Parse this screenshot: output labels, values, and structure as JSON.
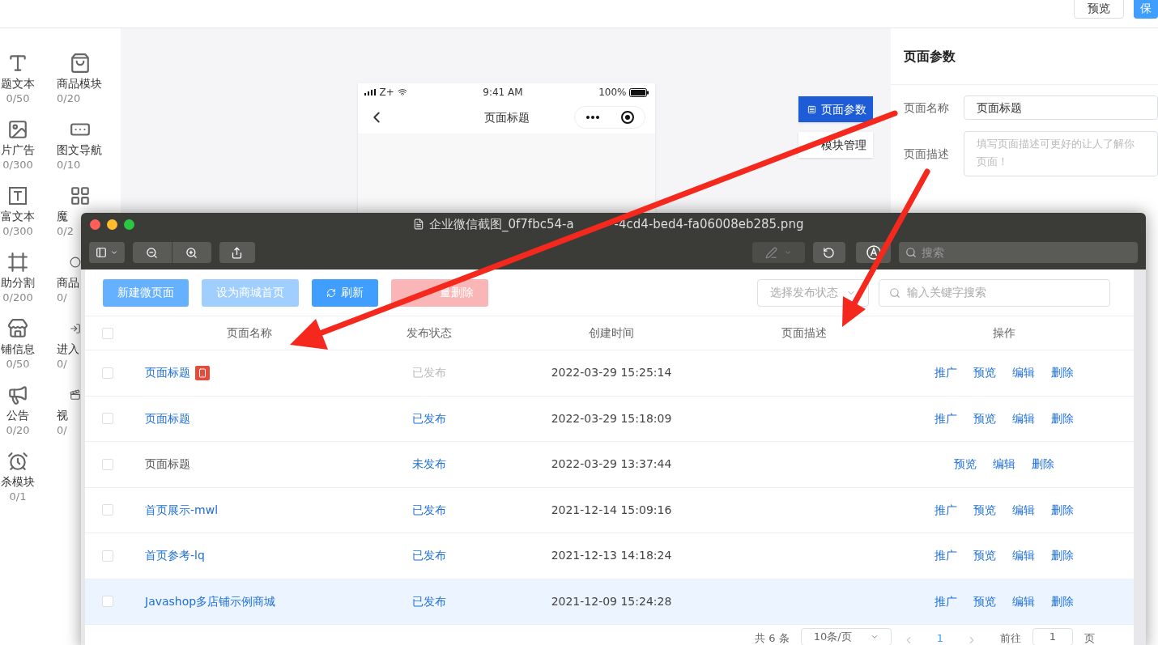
{
  "header": {
    "buttons": [
      {
        "label": "预览",
        "kind": "plain"
      },
      {
        "label": "保",
        "kind": "primary"
      }
    ]
  },
  "components": [
    {
      "label": "题文本",
      "count": "0/50"
    },
    {
      "label": "商品模块",
      "count": "0/20"
    },
    {
      "label": "片广告",
      "count": "0/300"
    },
    {
      "label": "图文导航",
      "count": "0/10"
    },
    {
      "label": "富文本",
      "count": "0/300"
    },
    {
      "label": "魔",
      "count": "0/2"
    },
    {
      "label": "助分割",
      "count": "0/200"
    },
    {
      "label": "商品",
      "count": "0/"
    },
    {
      "label": "铺信息",
      "count": "0/50"
    },
    {
      "label": "进入",
      "count": "0/"
    },
    {
      "label": "公告",
      "count": "0/20"
    },
    {
      "label": "视",
      "count": "0/"
    },
    {
      "label": "杀模块",
      "count": "0/1"
    }
  ],
  "phone": {
    "carrier": "Z+",
    "time": "9:41 AM",
    "battery": "100%",
    "title": "页面标题"
  },
  "canvas_tabs": [
    {
      "label": "页面参数",
      "selected": true
    },
    {
      "label": "模块管理",
      "selected": false
    }
  ],
  "settings": {
    "title": "页面参数",
    "fields": [
      {
        "label": "页面名称",
        "kind": "input",
        "value": "页面标题"
      },
      {
        "label": "页面描述",
        "kind": "textarea",
        "placeholder_lines": [
          "填写页面描述可更好的让人了解你",
          "页面！"
        ]
      }
    ]
  },
  "preview_window": {
    "title_start": "企业微信截图_0f7fbc54-a",
    "title_end": "-4cd4-bed4-fa06008eb285.png",
    "search_placeholder": "搜索",
    "toolbar_buttons": [
      {
        "label": "新建微页面",
        "kind": "primary"
      },
      {
        "label": "设为商城首页",
        "kind": "primary_disabled"
      },
      {
        "label": "刷新",
        "kind": "refresh"
      },
      {
        "label": "量删除",
        "kind": "danger_disabled"
      }
    ],
    "select_all_checked": false,
    "status_filter": {
      "placeholder": "选择发布状态"
    },
    "search": {
      "placeholder": "输入关键字搜索"
    },
    "columns": [
      "页面名称",
      "发布状态",
      "创建时间",
      "页面描述",
      "操作"
    ],
    "rows": [
      {
        "checked": false,
        "selected": false,
        "name": "页面标题",
        "linked": true,
        "badge": true,
        "status": "已发布",
        "status_disabled": true,
        "created": "2022-03-29 15:25:14",
        "actions": [
          "推广",
          "预览",
          "编辑",
          "删除"
        ]
      },
      {
        "checked": false,
        "selected": false,
        "name": "页面标题",
        "linked": true,
        "badge": false,
        "status": "已发布",
        "status_disabled": false,
        "created": "2022-03-29 15:18:09",
        "actions": [
          "推广",
          "预览",
          "编辑",
          "删除"
        ]
      },
      {
        "checked": false,
        "selected": false,
        "name": "页面标题",
        "linked": false,
        "badge": false,
        "status": "未发布",
        "status_disabled": false,
        "created": "2022-03-29 13:37:44",
        "actions": [
          "预览",
          "编辑",
          "删除"
        ]
      },
      {
        "checked": false,
        "selected": false,
        "name": "首页展示-mwl",
        "linked": true,
        "badge": false,
        "status": "已发布",
        "status_disabled": false,
        "created": "2021-12-14 15:09:16",
        "actions": [
          "推广",
          "预览",
          "编辑",
          "删除"
        ]
      },
      {
        "checked": false,
        "selected": false,
        "name": "首页参考-lq",
        "linked": true,
        "badge": false,
        "status": "已发布",
        "status_disabled": false,
        "created": "2021-12-13 14:18:24",
        "actions": [
          "推广",
          "预览",
          "编辑",
          "删除"
        ]
      },
      {
        "checked": false,
        "selected": true,
        "name": "Javashop多店铺示例商城",
        "linked": true,
        "badge": false,
        "status": "已发布",
        "status_disabled": false,
        "created": "2021-12-09 15:24:28",
        "actions": [
          "推广",
          "预览",
          "编辑",
          "删除"
        ]
      }
    ],
    "pagination": {
      "total": "共 6 条",
      "page_size": "10条/页",
      "current": "1",
      "goto_label": "前往",
      "goto_value": "1",
      "suffix": "页"
    }
  }
}
